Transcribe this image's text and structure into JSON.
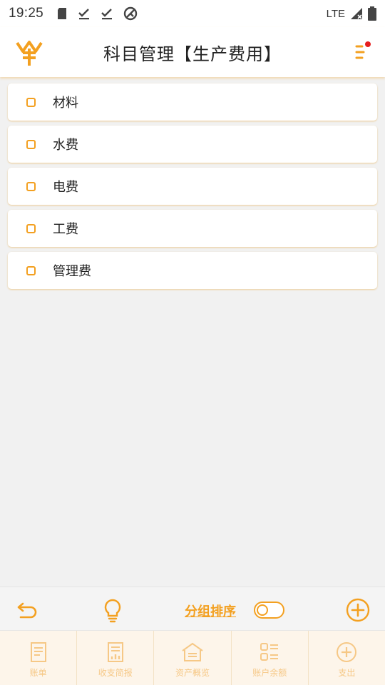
{
  "status_bar": {
    "time": "19:25",
    "network": "LTE"
  },
  "header": {
    "title": "科目管理【生产费用】"
  },
  "items": [
    {
      "label": "材料"
    },
    {
      "label": "水费"
    },
    {
      "label": "电费"
    },
    {
      "label": "工费"
    },
    {
      "label": "管理费"
    }
  ],
  "toolbar": {
    "sort_label": "分组排序"
  },
  "tabs": [
    {
      "label": "账单",
      "icon": "bill-icon"
    },
    {
      "label": "收支简报",
      "icon": "report-icon"
    },
    {
      "label": "资产概览",
      "icon": "assets-icon"
    },
    {
      "label": "账户余额",
      "icon": "balance-icon"
    },
    {
      "label": "支出",
      "icon": "expense-icon"
    }
  ],
  "colors": {
    "accent": "#f3a020",
    "notice": "#e61e1e",
    "tab_inactive": "#f6c886"
  }
}
